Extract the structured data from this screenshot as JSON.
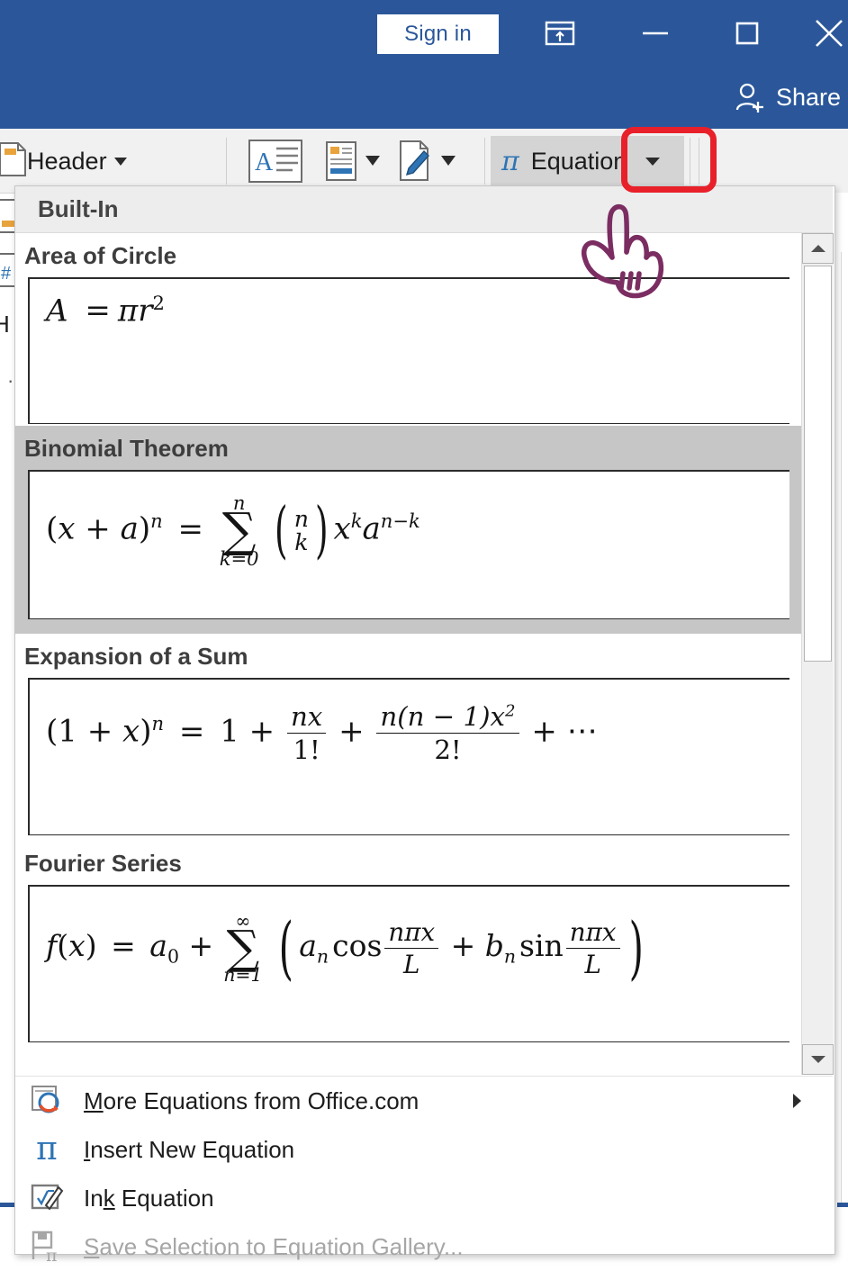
{
  "titlebar": {
    "signin_label": "Sign in",
    "ribbon_display_icon": "ribbon-display-options-icon",
    "minimize_icon": "minimize-icon",
    "maximize_icon": "maximize-icon",
    "close_icon": "close-icon",
    "share_label": "Share",
    "share_icon": "share-person-icon",
    "background_color": "#2b579a"
  },
  "ribbon": {
    "header_label": "Header",
    "header_icon": "header-gallery-icon",
    "header_caret": "chevron-down-icon",
    "textbox_icon": "text-box-icon",
    "quickparts_icon": "quick-parts-icon",
    "quickparts_caret": "chevron-down-icon",
    "wordart_icon": "signature-line-icon",
    "wordart_caret": "chevron-down-icon",
    "equation_label": "Equation",
    "equation_icon": "pi-icon",
    "equation_caret": "chevron-down-icon",
    "highlight_color": "#e8202a",
    "equation_button_bg": "#d4d4d4"
  },
  "edge_icons": {
    "footer_icon": "footer-gallery-icon",
    "page_number_icon": "page-number-icon",
    "clipped_text": "H",
    "clipped_dot": "·"
  },
  "gallery": {
    "header_label": "Built-In",
    "items": [
      {
        "title": "Area of Circle",
        "selected": false,
        "equation_text": "A = πr²"
      },
      {
        "title": "Binomial Theorem",
        "selected": true,
        "equation_text": "(x + a)ⁿ = ∑(k=0..n) (n choose k) xᵏ aⁿ⁻ᵏ"
      },
      {
        "title": "Expansion of a Sum",
        "selected": false,
        "equation_text": "(1 + x)ⁿ = 1 + nx/1! + n(n − 1)x²/2! + ⋯"
      },
      {
        "title": "Fourier Series",
        "selected": false,
        "equation_text": "f(x) = a₀ + ∑(n=1..∞) (aₙ cos nπx/L + bₙ sin nπx/L)"
      }
    ],
    "equations": {
      "area_of_circle": {
        "lhs": "A",
        "eq": "=",
        "pi": "π",
        "r": "r",
        "exp": "2"
      },
      "binomial": {
        "open": "(",
        "x": "x",
        "plus": "+",
        "a": "a",
        "close": ")",
        "n1": "n",
        "eq": "=",
        "sigma": "∑",
        "upper": "n",
        "lower": "k=0",
        "binom_n": "n",
        "binom_k": "k",
        "x2": "x",
        "k2": "k",
        "a2": "a",
        "nk": "n−k"
      },
      "expansion": {
        "open": "(",
        "one": "1",
        "plus": "+",
        "x": "x",
        "close": ")",
        "n": "n",
        "eq": "=",
        "one2": "1",
        "plus2": "+",
        "num1": "nx",
        "den1": "1!",
        "plus3": "+",
        "num2_a": "n(n − 1)x",
        "num2_sup": "2",
        "den2": "2!",
        "plus4": "+",
        "dots": "⋯"
      },
      "fourier": {
        "f": "f",
        "open1": "(",
        "x1": "x",
        "close1": ")",
        "eq": "=",
        "a0": "a",
        "a0sub": "0",
        "plus": "+",
        "sigma": "∑",
        "upper": "∞",
        "lower": "n=1",
        "lparen": "(",
        "an": "a",
        "ansub": "n",
        "cos": "cos",
        "num1": "nπx",
        "den1": "L",
        "plus2": "+",
        "bn": "b",
        "bnsub": "n",
        "sin": "sin",
        "num2": "nπx",
        "den2": "L",
        "rparen": ")"
      }
    },
    "selected_background": "#c6c6c6",
    "scrollbar": {
      "up_icon": "scroll-up-arrow-icon",
      "down_icon": "scroll-down-arrow-icon",
      "thumb": "scrollbar-thumb"
    }
  },
  "menu_footer": {
    "items": [
      {
        "label_pre": "",
        "label_accel": "M",
        "label_post": "ore Equations from Office.com",
        "icon": "office-online-equations-icon",
        "disabled": false,
        "has_submenu": true
      },
      {
        "label_pre": "",
        "label_accel": "I",
        "label_post": "nsert New Equation",
        "icon": "pi-icon",
        "disabled": false,
        "has_submenu": false
      },
      {
        "label_pre": "In",
        "label_accel": "k",
        "label_post": " Equation",
        "icon": "ink-equation-icon",
        "disabled": false,
        "has_submenu": false
      },
      {
        "label_pre": "",
        "label_accel": "S",
        "label_post": "ave Selection to Equation Gallery...",
        "icon": "save-equation-gallery-icon",
        "disabled": true,
        "has_submenu": false
      }
    ],
    "submenu_arrow_icon": "chevron-right-icon"
  },
  "cursor": {
    "icon": "hand-pointer-cursor",
    "color": "#7b2d62"
  }
}
